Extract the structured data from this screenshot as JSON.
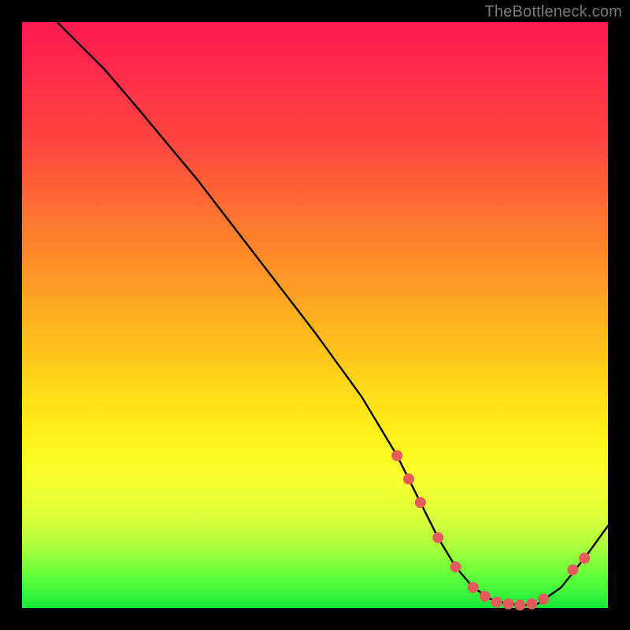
{
  "watermark": "TheBottleneck.com",
  "colors": {
    "page_bg": "#000000",
    "dot": "#e35b5b",
    "line": "#000000",
    "gradient_stops": [
      "#ff1b52",
      "#ff2b4b",
      "#ff4a3e",
      "#ff7a2e",
      "#ffa722",
      "#ffd018",
      "#fff015",
      "#f8ff2e",
      "#d8ff3a",
      "#a6ff3c",
      "#5cff3a",
      "#18e83a"
    ]
  },
  "chart_data": {
    "type": "line",
    "title": "",
    "xlabel": "",
    "ylabel": "",
    "xlim": [
      0,
      100
    ],
    "ylim": [
      0,
      100
    ],
    "grid": false,
    "legend": false,
    "series": [
      {
        "name": "curve",
        "x": [
          6,
          10,
          14,
          20,
          30,
          40,
          50,
          58,
          64,
          68,
          71,
          74,
          77,
          80,
          83,
          86,
          88,
          92,
          96,
          100
        ],
        "y": [
          100,
          96,
          92,
          85,
          73,
          60,
          47,
          36,
          26,
          18,
          12,
          7,
          3.5,
          1.5,
          0.7,
          0.5,
          0.7,
          3.5,
          8.5,
          14
        ]
      }
    ],
    "markers": [
      {
        "x": 64,
        "y": 26
      },
      {
        "x": 66,
        "y": 22
      },
      {
        "x": 68,
        "y": 18
      },
      {
        "x": 71,
        "y": 12
      },
      {
        "x": 74,
        "y": 7
      },
      {
        "x": 77,
        "y": 3.5
      },
      {
        "x": 79,
        "y": 2
      },
      {
        "x": 81,
        "y": 1
      },
      {
        "x": 83,
        "y": 0.7
      },
      {
        "x": 85,
        "y": 0.5
      },
      {
        "x": 87,
        "y": 0.7
      },
      {
        "x": 89,
        "y": 1.5
      },
      {
        "x": 94,
        "y": 6.5
      },
      {
        "x": 96,
        "y": 8.5
      }
    ]
  }
}
